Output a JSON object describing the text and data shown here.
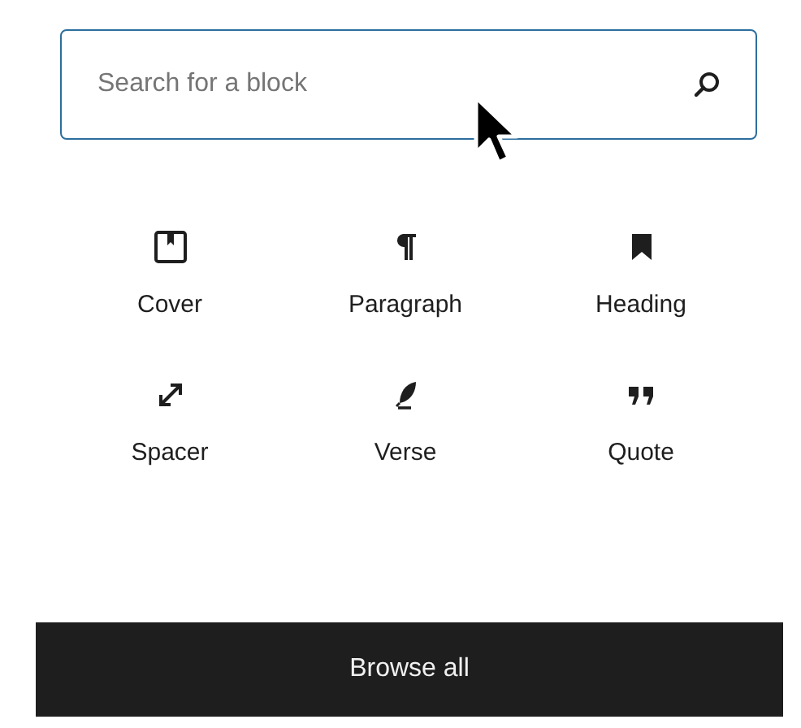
{
  "search": {
    "placeholder": "Search for a block"
  },
  "blocks": [
    {
      "label": "Cover",
      "kind": "cover"
    },
    {
      "label": "Paragraph",
      "kind": "paragraph"
    },
    {
      "label": "Heading",
      "kind": "heading"
    },
    {
      "label": "Spacer",
      "kind": "spacer"
    },
    {
      "label": "Verse",
      "kind": "verse"
    },
    {
      "label": "Quote",
      "kind": "quote"
    }
  ],
  "browse_button": {
    "label": "Browse all"
  }
}
